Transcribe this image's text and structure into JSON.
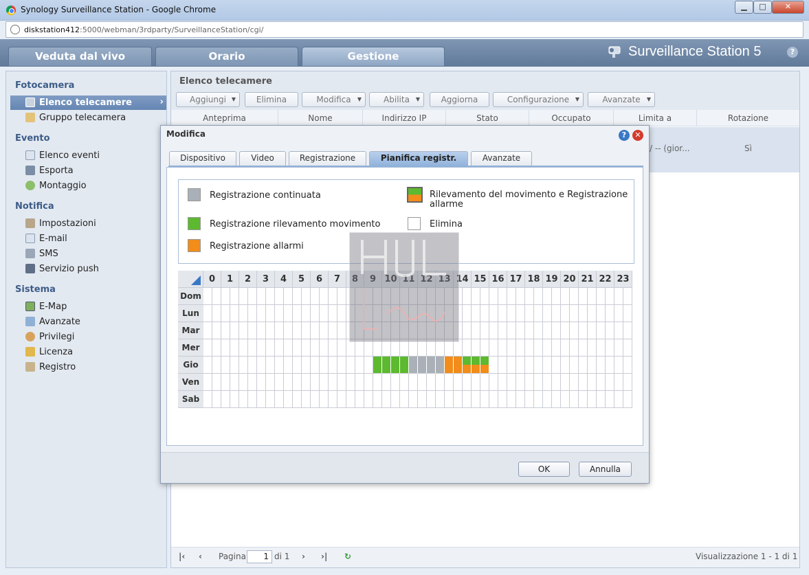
{
  "window": {
    "title": "Synology Surveillance Station - Google Chrome",
    "url_host": "diskstation412",
    "url_rest": ":5000/webman/3rdparty/SurveillanceStation/cgi/",
    "min": "▁",
    "max": "□",
    "close": "✕"
  },
  "header": {
    "tabs": [
      "Veduta dal vivo",
      "Orario",
      "Gestione"
    ],
    "brand": "Surveillance Station 5",
    "help": "?"
  },
  "sidebar": {
    "groups": [
      "Fotocamera",
      "Evento",
      "Notifica",
      "Sistema"
    ],
    "items": [
      {
        "label": "Elenco telecamere",
        "icon": "camera-icon"
      },
      {
        "label": "Gruppo telecamera",
        "icon": "folder-icon"
      },
      {
        "label": "Elenco eventi",
        "icon": "list-icon"
      },
      {
        "label": "Esporta",
        "icon": "export-icon"
      },
      {
        "label": "Montaggio",
        "icon": "montage-icon"
      },
      {
        "label": "Impostazioni",
        "icon": "wrench-icon"
      },
      {
        "label": "E-mail",
        "icon": "mail-icon"
      },
      {
        "label": "SMS",
        "icon": "sms-icon"
      },
      {
        "label": "Servizio push",
        "icon": "phone-icon"
      },
      {
        "label": "E-Map",
        "icon": "map-icon"
      },
      {
        "label": "Avanzate",
        "icon": "advanced-icon"
      },
      {
        "label": "Privilegi",
        "icon": "users-icon"
      },
      {
        "label": "Licenza",
        "icon": "key-icon"
      },
      {
        "label": "Registro",
        "icon": "book-icon"
      }
    ],
    "active_arrow": "›"
  },
  "content": {
    "title": "Elenco telecamere",
    "toolbar": {
      "add": "Aggiungi",
      "delete": "Elimina",
      "edit": "Modifica",
      "enable": "Abilita",
      "refresh": "Aggiorna",
      "config": "Configurazione",
      "advanced": "Avanzate"
    },
    "columns": [
      "Anteprima",
      "Nome",
      "Indirizzo IP",
      "Stato",
      "Occupato",
      "Limita a",
      "Rotazione"
    ],
    "row": {
      "limit": "/ -- (gior...",
      "rotation": "Sì"
    },
    "pager": {
      "page_label": "Pagina",
      "page_value": "1",
      "of": "di 1",
      "summary": "Visualizzazione 1 - 1 di 1"
    }
  },
  "modal": {
    "title": "Modifica",
    "help": "?",
    "close": "✕",
    "tabs": [
      "Dispositivo",
      "Video",
      "Registrazione",
      "Pianifica registr.",
      "Avanzate"
    ],
    "active_tab": 3,
    "legend": {
      "continuous": "Registrazione continuata",
      "motion": "Registrazione rilevamento movimento",
      "alarm": "Registrazione allarme",
      "alarm_full": "Registrazione allarmi",
      "motion_alarm": "Rilevamento del movimento e Registrazione allarme",
      "delete": "Elimina"
    },
    "schedule": {
      "hours": [
        "0",
        "1",
        "2",
        "3",
        "4",
        "5",
        "6",
        "7",
        "8",
        "9",
        "10",
        "11",
        "12",
        "13",
        "14",
        "15",
        "16",
        "17",
        "18",
        "19",
        "20",
        "21",
        "22",
        "23"
      ],
      "days": [
        "Dom",
        "Lun",
        "Mar",
        "Mer",
        "Gio",
        "Ven",
        "Sab"
      ],
      "legend_codes": {
        "m": "motion",
        "c": "continuous",
        "a": "alarm",
        "ma": "motion_alarm"
      },
      "rows": {
        "Gio": [
          "",
          "",
          "",
          "",
          "",
          "",
          "",
          "",
          "",
          "",
          "",
          "",
          "",
          "",
          "",
          "",
          "",
          "",
          "",
          "m",
          "m",
          "m",
          "m",
          "c",
          "c",
          "c",
          "c",
          "a",
          "a",
          "ma",
          "ma",
          "ma",
          "",
          "",
          "",
          "",
          "",
          "",
          "",
          "",
          "",
          "",
          "",
          "",
          "",
          "",
          "",
          ""
        ]
      }
    },
    "ok": "OK",
    "cancel": "Annulla"
  },
  "colors": {
    "motion": "#5db92f",
    "continuous": "#aab0b7",
    "alarm": "#f28c1a"
  }
}
